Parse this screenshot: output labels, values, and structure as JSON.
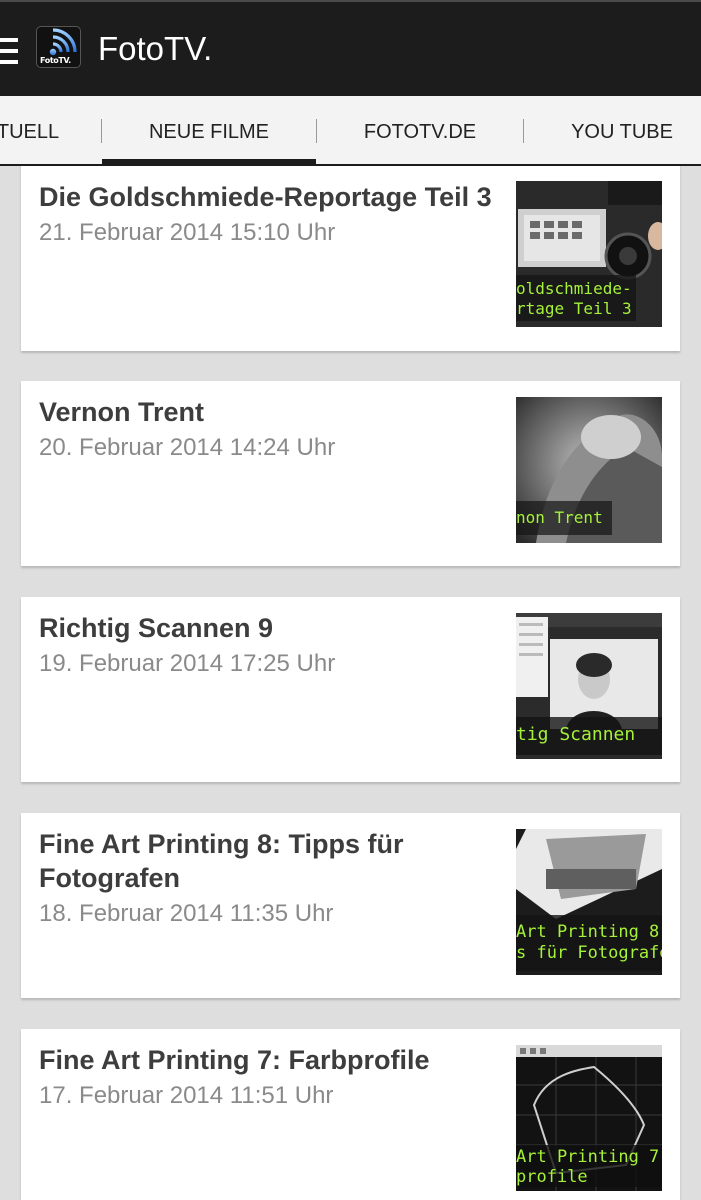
{
  "app": {
    "title": "FotoTV.",
    "logo_text": "FotoTV.",
    "menu_icon": "hamburger-menu-icon",
    "logo_icon": "rss-feed-icon"
  },
  "tabs": [
    {
      "label": "AKTUELL",
      "visible_label": "TUELL",
      "active": false
    },
    {
      "label": "NEUE FILME",
      "active": true
    },
    {
      "label": "FOTOTV.DE",
      "active": false
    },
    {
      "label": "YOU TUBE",
      "active": false
    }
  ],
  "items": [
    {
      "title": "Die Goldschmiede-Reportage Teil 3",
      "date": "21. Februar 2014 15:10 Uhr",
      "thumb_caption": [
        "oldschmiede-",
        "rtage Teil 3"
      ]
    },
    {
      "title": "Vernon Trent",
      "date": "20. Februar 2014 14:24 Uhr",
      "thumb_caption": [
        "non Trent"
      ]
    },
    {
      "title": "Richtig Scannen 9",
      "date": "19. Februar 2014 17:25 Uhr",
      "thumb_caption": [
        "tig Scannen"
      ]
    },
    {
      "title": "Fine Art Printing 8: Tipps für",
      "title_line2": "Fotografen",
      "date": "18. Februar 2014 11:35 Uhr",
      "thumb_caption": [
        " Art Printing 8:",
        "s für Fotografe"
      ]
    },
    {
      "title": "Fine Art Printing 7: Farbprofile",
      "date": "17. Februar 2014 11:51 Uhr",
      "thumb_caption": [
        " Art Printing 7:",
        "profile"
      ]
    }
  ],
  "colors": {
    "appbar": "#1c1c1c",
    "caption_green": "#a6f23a",
    "background": "#dedede"
  }
}
